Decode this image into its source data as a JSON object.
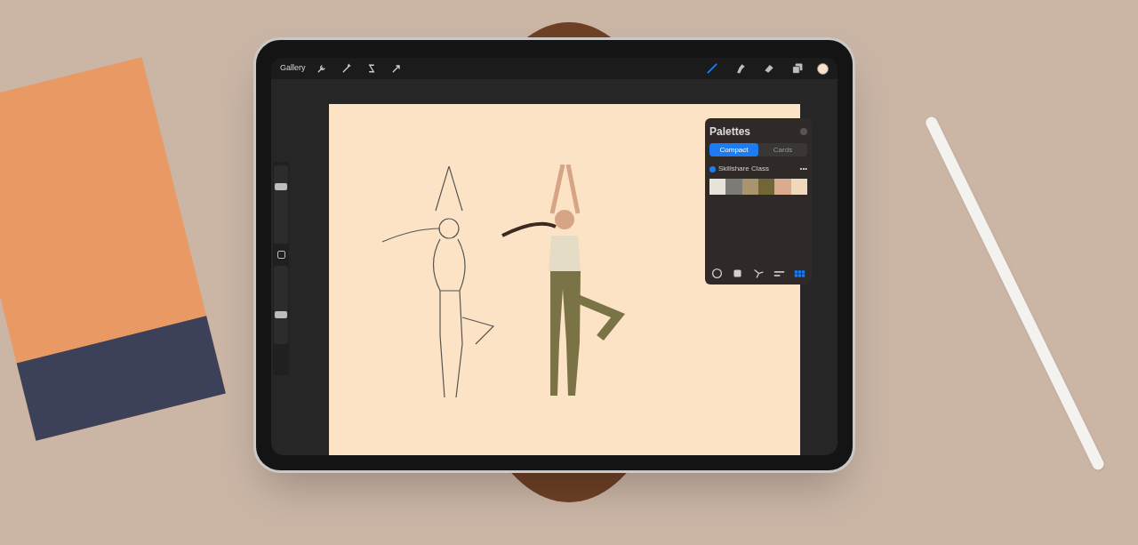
{
  "toolbar": {
    "gallery": "Gallery",
    "actions": [
      {
        "kind": "wrench"
      },
      {
        "kind": "wand"
      },
      {
        "kind": "selection"
      },
      {
        "kind": "transform"
      }
    ],
    "tools": [
      {
        "kind": "brush",
        "selected": true
      },
      {
        "kind": "smudge",
        "selected": false
      },
      {
        "kind": "eraser",
        "selected": false
      },
      {
        "kind": "layers",
        "selected": false
      }
    ],
    "current_color": {
      "color": "#fbe0c4"
    }
  },
  "sidebar": {
    "sliders": [
      {
        "level": 0.75
      },
      {
        "level": 0.35
      }
    ]
  },
  "palettes": {
    "title": "Palettes",
    "tabs": [
      {
        "label": "Compact",
        "selected": true
      },
      {
        "label": "Cards",
        "selected": false
      }
    ],
    "palette": {
      "name": "Skillshare Class",
      "checked": true,
      "more": "•••",
      "swatches": [
        {
          "color": "#e8e3da"
        },
        {
          "color": "#7d7b76"
        },
        {
          "color": "#a89570"
        },
        {
          "color": "#736636"
        },
        {
          "color": "#dbab8f"
        },
        {
          "color": "#efd8bb"
        }
      ]
    },
    "modes": [
      {
        "kind": "disc",
        "selected": false
      },
      {
        "kind": "classic",
        "selected": false
      },
      {
        "kind": "harmony",
        "selected": false
      },
      {
        "kind": "value",
        "selected": false
      },
      {
        "kind": "palettes",
        "selected": true
      }
    ]
  }
}
